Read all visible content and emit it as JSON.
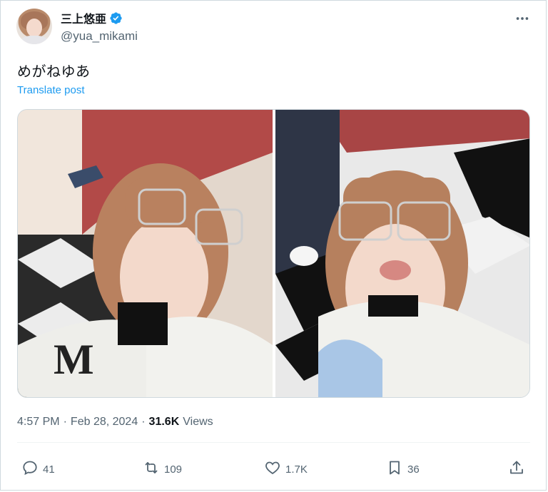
{
  "author": {
    "display_name": "三上悠亜",
    "handle": "@yua_mikami",
    "verified": true
  },
  "tweet": {
    "text": "めがねゆあ",
    "translate_label": "Translate post"
  },
  "meta": {
    "time": "4:57 PM",
    "date": "Feb 28, 2024",
    "views_count": "31.6K",
    "views_label": "Views",
    "separator": "·"
  },
  "actions": {
    "replies": "41",
    "reposts": "109",
    "likes": "1.7K",
    "bookmarks": "36"
  },
  "colors": {
    "link_blue": "#1d9bf0",
    "secondary_text": "#536471",
    "primary_text": "#0f1419",
    "border": "#cfd9de"
  },
  "icons": [
    "verified-badge-icon",
    "more-icon",
    "reply-icon",
    "retweet-icon",
    "like-icon",
    "bookmark-icon",
    "share-icon"
  ]
}
